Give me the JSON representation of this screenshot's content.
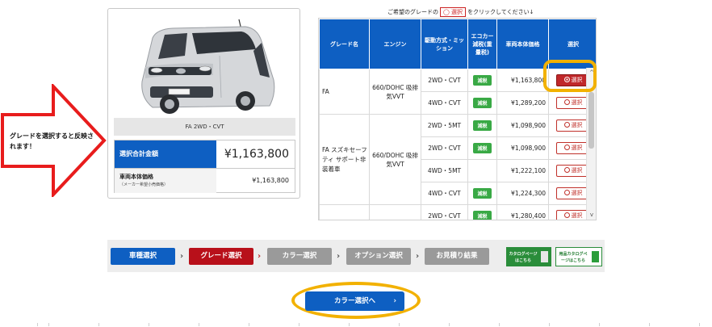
{
  "car": {
    "caption": "FA 2WD・CVT"
  },
  "summary": {
    "total_label": "選択合計金額",
    "total_value": "¥1,163,800",
    "base_label": "車両本体価格",
    "base_sub": "（メーカー希望小売価格）",
    "base_value": "¥1,163,800"
  },
  "callout": {
    "text": "グレードを選択すると反映されます！",
    "color": "#e81c1c"
  },
  "hint": {
    "prefix": "ご希望のグレードの",
    "box": "◯ 選択",
    "suffix": "をクリックしてください↓"
  },
  "table": {
    "headers": [
      "グレード名",
      "エンジン",
      "駆動方式・ミッション",
      "エコカー減税(重量税)",
      "車両本体価格",
      "選択"
    ],
    "rows": [
      {
        "grade": "FA",
        "engine": "660/DOHC 吸排気VVT",
        "drive": "2WD・CVT",
        "eco": "減税",
        "price": "¥1,163,800",
        "select": "選択",
        "active": true
      },
      {
        "grade": "",
        "engine": "",
        "drive": "4WD・CVT",
        "eco": "減税",
        "price": "¥1,289,200",
        "select": "選択",
        "active": false
      },
      {
        "grade": "FA スズキセーフティ サポート非装着車",
        "engine": "660/DOHC 吸排気VVT",
        "drive": "2WD・5MT",
        "eco": "減税",
        "price": "¥1,098,900",
        "select": "選択",
        "active": false
      },
      {
        "grade": "",
        "engine": "",
        "drive": "2WD・CVT",
        "eco": "減税",
        "price": "¥1,098,900",
        "select": "選択",
        "active": false
      },
      {
        "grade": "",
        "engine": "",
        "drive": "4WD・5MT",
        "eco": "",
        "price": "¥1,222,100",
        "select": "選択",
        "active": false
      },
      {
        "grade": "",
        "engine": "",
        "drive": "4WD・CVT",
        "eco": "減税",
        "price": "¥1,224,300",
        "select": "選択",
        "active": false
      },
      {
        "grade": "",
        "engine": "",
        "drive": "2WD・CVT",
        "eco": "減税",
        "price": "¥1,280,400",
        "select": "選択",
        "active": false
      }
    ]
  },
  "steps": {
    "items": [
      "車種選択",
      "グレード選択",
      "カラー選択",
      "オプション選択",
      "お見積り結果"
    ],
    "catalog1": "カタログページはこちら",
    "catalog2": "用品カタログページはこちら"
  },
  "next_button": {
    "label": "カラー選択へ",
    "chevron": "›"
  },
  "colors": {
    "brand_blue": "#0e5fc2",
    "active_red": "#c0282a",
    "eco_green": "#39a945",
    "highlight": "#f2b100"
  }
}
